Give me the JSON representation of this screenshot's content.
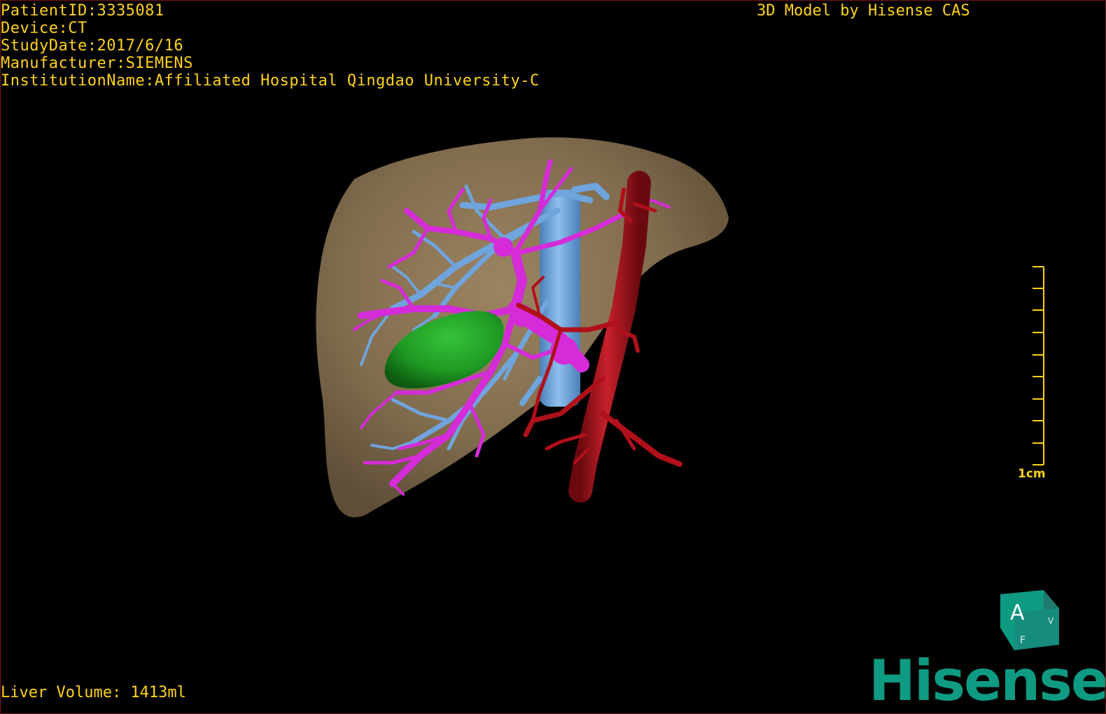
{
  "window": {
    "border_color": "#7a1010",
    "background": "#000000"
  },
  "study_info": {
    "patient_id": "PatientID:3335081",
    "device": "Device:CT",
    "study_date": "StudyDate:2017/6/16",
    "manufacturer": "Manufacturer:SIEMENS",
    "institution": "InstitutionName:Affiliated Hospital Qingdao University-C"
  },
  "credit": "3D Model by Hisense CAS",
  "liver_volume": "Liver Volume: 1413ml",
  "scale_bar": {
    "label": "1cm",
    "ticks": 10
  },
  "orientation_cube": {
    "front_label": "A",
    "bottom_label": "F",
    "side_label": "V"
  },
  "logo": {
    "text": "Hisense",
    "color": "#0f9a82"
  },
  "model": {
    "structures": [
      {
        "name": "liver",
        "color": "#8a7555"
      },
      {
        "name": "hepatic-veins",
        "color": "#6fa4dc"
      },
      {
        "name": "portal-vein",
        "color": "#d52bd8"
      },
      {
        "name": "hepatic-artery",
        "color": "#b0101a"
      },
      {
        "name": "tumor",
        "color": "#1f9a23"
      }
    ]
  },
  "colors": {
    "text": "#ffd21a"
  }
}
